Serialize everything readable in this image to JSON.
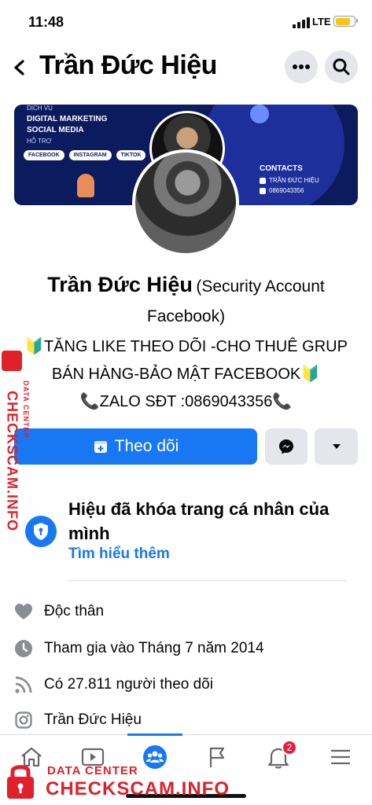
{
  "status_bar": {
    "time": "11:48",
    "network": "LTE",
    "battery_level": 0.8
  },
  "header": {
    "title": "Trần Đức Hiệu",
    "more_icon": "more-icon",
    "search_icon": "search-icon"
  },
  "cover": {
    "service_label": "DỊCH VỤ",
    "headline_1": "DIGITAL MARKETING",
    "headline_2": "SOCIAL MEDIA",
    "support_label": "HỖ TRỢ",
    "pills": [
      "FACEBOOK",
      "INSTAGRAM",
      "TIKTOK"
    ],
    "contacts_title": "CONTACTS",
    "contact_name": "TRẦN ĐỨC HIỆU",
    "contact_phone": "0869043356"
  },
  "profile": {
    "name": "Trần Đức Hiệu",
    "subtitle": "(Security Account Facebook)",
    "bio_line_1": "🔰TĂNG LIKE THEO DÕI -CHO THUÊ GRUP",
    "bio_line_2": "BÁN HÀNG-BẢO MẬT FACEBOOK🔰",
    "bio_line_3": "📞ZALO SĐT :0869043356📞"
  },
  "actions": {
    "follow_label": "Theo dõi",
    "accent": "#1877f2"
  },
  "locked": {
    "title": "Hiệu đã khóa trang cá nhân của mình",
    "link": "Tìm hiểu thêm"
  },
  "info": [
    {
      "icon": "heart-icon",
      "text": "Độc thân"
    },
    {
      "icon": "clock-icon",
      "text": "Tham gia vào Tháng 7 năm 2014"
    },
    {
      "icon": "rss-icon",
      "text": "Có 27.811 người theo dõi"
    },
    {
      "icon": "instagram-icon",
      "text": "Trần Đức Hiệu"
    }
  ],
  "bottom_nav": {
    "notification_count": "2",
    "active_tab": "groups"
  },
  "watermark": {
    "side_big": "CHECKSCAM.INFO",
    "side_small": "DATA CENTER",
    "bottom_small": "DATA CENTER",
    "bottom_big": "CHECKSCAM.INFO"
  }
}
